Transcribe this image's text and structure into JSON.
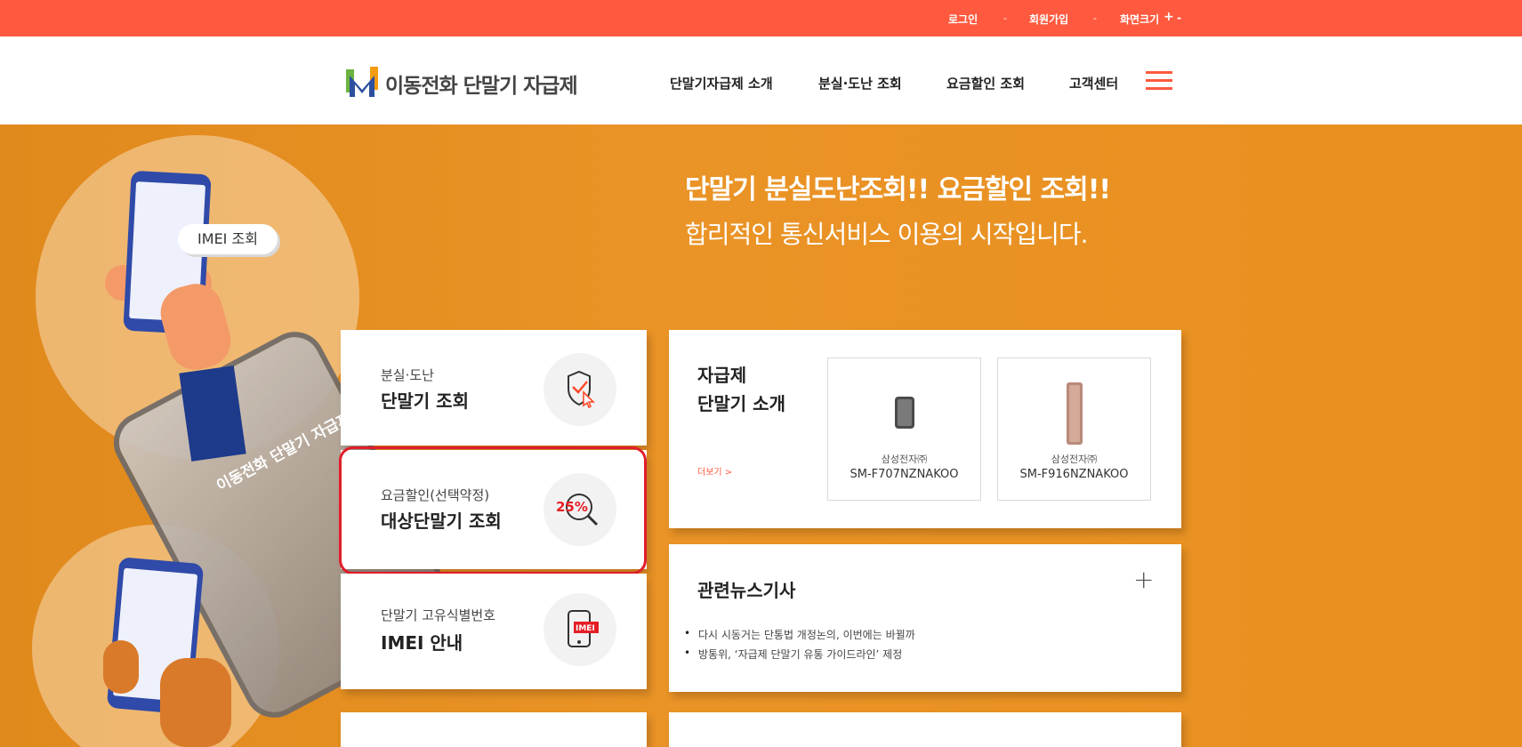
{
  "topbar": {
    "login": "로그인",
    "join": "회원가입",
    "font_size": "화면크기",
    "font_plus": "+",
    "font_minus": "-",
    "separator": "-"
  },
  "header": {
    "logo_text": "이동전화 단말기 자급제",
    "nav": [
      "단말기자급제 소개",
      "분실·도난 조회",
      "요금할인 조회",
      "고객센터"
    ]
  },
  "hero": {
    "title": "단말기 분실도난조회!! 요금할인 조회!!",
    "subtitle": "합리적인 통신서비스 이용의 시작입니다.",
    "bubble": "IMEI 조회",
    "phone_brand": "이동전화 단말기 자급제"
  },
  "quick_cards": [
    {
      "small": "분실·도난",
      "big": "단말기 조회",
      "icon": "shield-check-cursor-icon"
    },
    {
      "small": "요금할인(선택약정)",
      "big": "대상단말기 조회",
      "icon": "discount-magnifier-icon",
      "badge": "25%"
    },
    {
      "small": "단말기 고유식별번호",
      "big": "IMEI 안내",
      "icon": "phone-imei-icon",
      "badge": "IMEI"
    }
  ],
  "devices": {
    "title_line1": "자급제",
    "title_line2": "단말기 소개",
    "more": "더보기 >",
    "items": [
      {
        "maker": "삼성전자㈜",
        "model": "SM-F707NZNAKOO"
      },
      {
        "maker": "삼성전자㈜",
        "model": "SM-F916NZNAKOO"
      }
    ]
  },
  "news": {
    "title": "관련뉴스기사",
    "expand": "+",
    "items": [
      "다시 시동거는 단통법 개정논의, 이번에는 바뀔까",
      "방통위, ‘자급제 단말기 유통 가이드라인’ 제정"
    ]
  },
  "colors": {
    "topbar": "#ff5a3f",
    "hero": "#e8901e",
    "highlight": "#e01e2b"
  }
}
